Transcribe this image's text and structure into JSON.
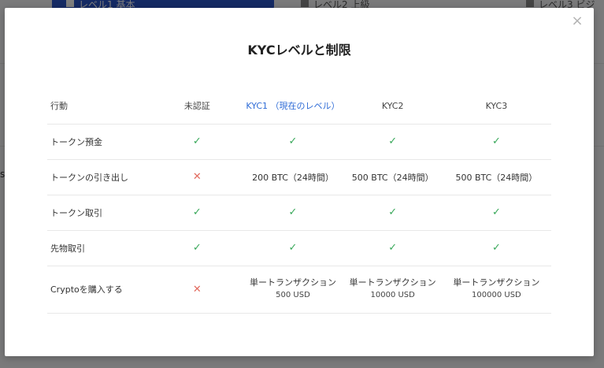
{
  "background": {
    "tab1_label": "レベル1 基本",
    "tab2_label": "レベル2 上級",
    "tab3_label": "レベル3 ビジ",
    "side_fragment": "s"
  },
  "modal": {
    "close_symbol": "×",
    "title": "KYCレベルと制限",
    "columns": {
      "action": "行動",
      "unverified": "未認証",
      "kyc1": "KYC1 （現在のレベル）",
      "kyc2": "KYC2",
      "kyc3": "KYC3"
    },
    "rows": [
      {
        "action": "トークン預金",
        "unverified": "✓",
        "kyc1": "✓",
        "kyc2": "✓",
        "kyc3": "✓"
      },
      {
        "action": "トークンの引き出し",
        "unverified": "✕",
        "kyc1": "200 BTC（24時間）",
        "kyc2": "500 BTC（24時間）",
        "kyc3": "500 BTC（24時間）"
      },
      {
        "action": "トークン取引",
        "unverified": "✓",
        "kyc1": "✓",
        "kyc2": "✓",
        "kyc3": "✓"
      },
      {
        "action": "先物取引",
        "unverified": "✓",
        "kyc1": "✓",
        "kyc2": "✓",
        "kyc3": "✓"
      },
      {
        "action": "Cryptoを購入する",
        "unverified": "✕",
        "kyc1": {
          "line1": "単ートランザクション",
          "line2": "500 USD"
        },
        "kyc2": {
          "line1": "単ートランザクション",
          "line2": "10000 USD"
        },
        "kyc3": {
          "line1": "単ートランザクション",
          "line2": "100000 USD"
        }
      }
    ]
  },
  "colors": {
    "check": "#39a85a",
    "cross": "#e26a5e",
    "current_level": "#2e6bd6"
  }
}
